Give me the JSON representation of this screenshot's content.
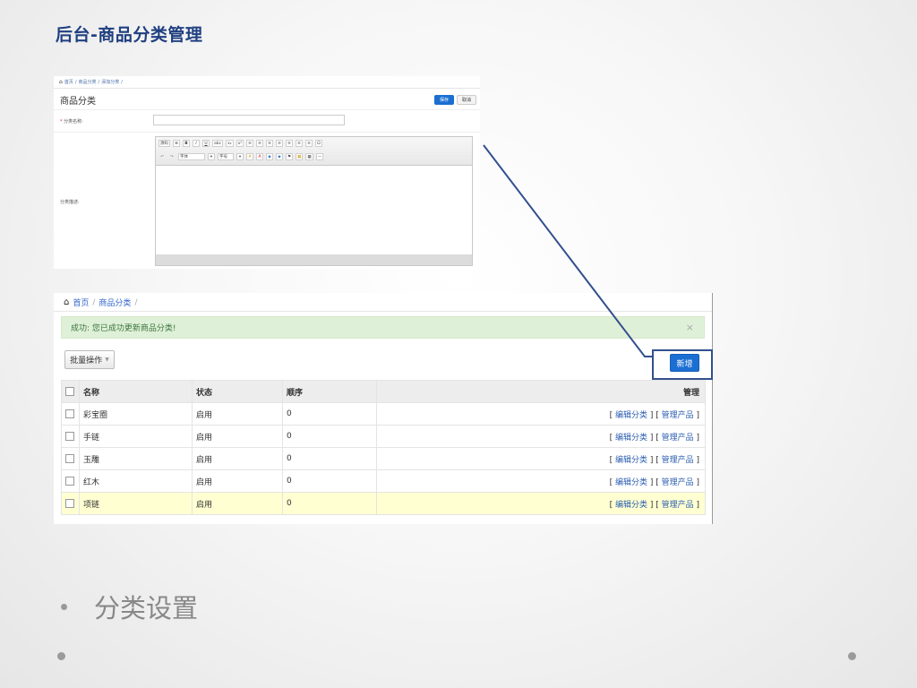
{
  "slide": {
    "title": "后台-商品分类管理",
    "bullet": "分类设置"
  },
  "top_screenshot": {
    "breadcrumb": [
      "首页",
      "商品分类",
      "添加分类"
    ],
    "page_title": "商品分类",
    "save_label": "保存",
    "cancel_label": "取消",
    "name_required": "*",
    "name_label": "分类名称",
    "name_value": "",
    "desc_label": "分类描述",
    "editor_toolbar_row1": [
      "源码",
      "⊕",
      "B",
      "I",
      "U",
      "abc",
      "x₂",
      "x²",
      "≡",
      "≡",
      "≡",
      "≡",
      "≡",
      "≡",
      "≡",
      "Ω"
    ],
    "editor_toolbar_row2": [
      "↶",
      "↷",
      "字体",
      "▾",
      "字号",
      "▾",
      "A",
      "A",
      "◆",
      "◆",
      "⚑",
      "▦",
      "▦",
      "—"
    ]
  },
  "bottom_screenshot": {
    "breadcrumb_home": "首页",
    "breadcrumb_current": "商品分类",
    "alert_text": "成功: 您已成功更新商品分类!",
    "alert_close": "×",
    "batch_label": "批量操作",
    "new_label": "新增",
    "headers": {
      "name": "名称",
      "status": "状态",
      "order": "顺序",
      "manage": "管理"
    },
    "rows": [
      {
        "name": "彩宝圈",
        "status": "启用",
        "order": "0",
        "edit": "编辑分类",
        "products": "管理产品"
      },
      {
        "name": "手链",
        "status": "启用",
        "order": "0",
        "edit": "编辑分类",
        "products": "管理产品"
      },
      {
        "name": "玉雕",
        "status": "启用",
        "order": "0",
        "edit": "编辑分类",
        "products": "管理产品"
      },
      {
        "name": "红木",
        "status": "启用",
        "order": "0",
        "edit": "编辑分类",
        "products": "管理产品"
      },
      {
        "name": "项链",
        "status": "启用",
        "order": "0",
        "edit": "编辑分类",
        "products": "管理产品"
      }
    ]
  },
  "colors": {
    "title": "#1f3f80",
    "primary_button": "#1b6fd3",
    "alert_bg": "#dff0d8",
    "highlight_row": "#ffffd2",
    "connector": "#33508e"
  }
}
